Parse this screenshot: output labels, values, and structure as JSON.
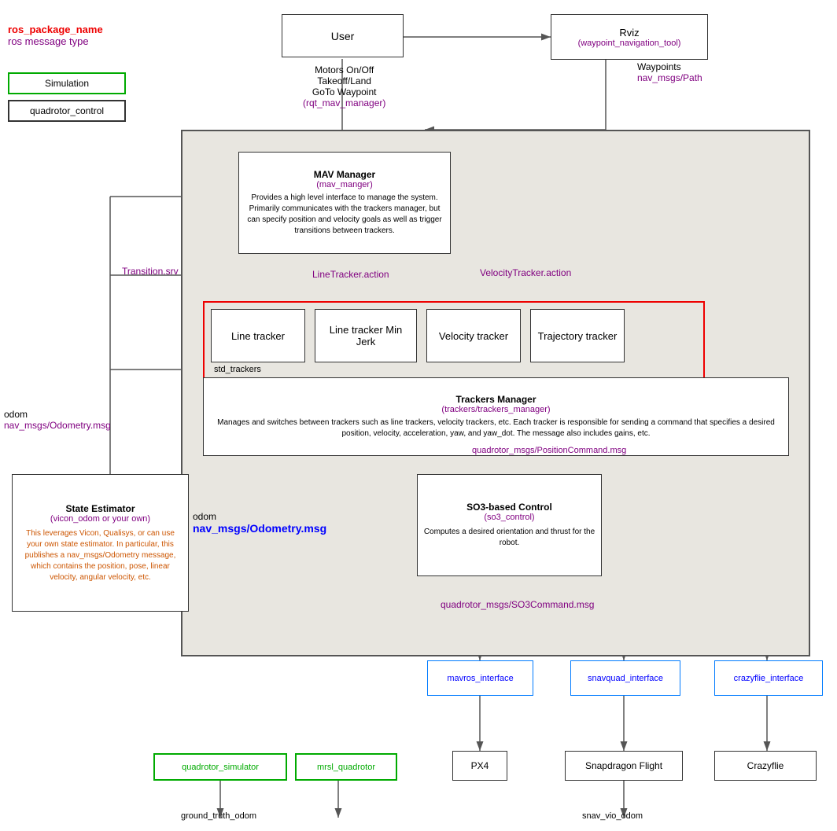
{
  "legend": {
    "ros_package_name": "ros_package_name",
    "ros_message_type": "ros message type",
    "simulation_label": "Simulation",
    "quadrotor_control_label": "quadrotor_control"
  },
  "nodes": {
    "user": {
      "label": "User"
    },
    "rviz": {
      "line1": "Rviz",
      "line2": "(waypoint_navigation_tool)"
    },
    "mav_manager": {
      "title": "MAV Manager",
      "subtitle": "(mav_manger)",
      "desc": "Provides a high level interface to manage the system. Primarily communicates with the trackers manager, but can specify position and velocity goals as well as trigger transitions between trackers."
    },
    "line_tracker": {
      "label": "Line tracker"
    },
    "line_tracker_min_jerk": {
      "label": "Line tracker Min Jerk"
    },
    "velocity_tracker": {
      "label": "Velocity tracker"
    },
    "trajectory_tracker": {
      "label": "Trajectory tracker"
    },
    "std_trackers": {
      "label": "std_trackers"
    },
    "trackers_manager": {
      "title": "Trackers Manager",
      "subtitle": "(trackers/trackers_manager)",
      "desc": "Manages and switches between trackers such as line trackers, velocity trackers, etc. Each tracker is responsible for sending a command that specifies a desired position, velocity, acceleration, yaw, and yaw_dot. The message also includes gains, etc."
    },
    "so3_control": {
      "title": "SO3-based Control",
      "subtitle": "(so3_control)",
      "desc": "Computes a desired orientation and thrust for the robot."
    },
    "state_estimator": {
      "title": "State Estimator",
      "subtitle": "(vicon_odom or your own)",
      "desc": "This leverages Vicon, Qualisys, or can use your own state estimator. In particular, this publishes a nav_msgs/Odometry message, which contains the position, pose, linear velocity, angular velocity, etc."
    },
    "mavros": {
      "label": "mavros_interface"
    },
    "snavquad": {
      "label": "snavquad_interface"
    },
    "crazyflie": {
      "label": "crazyflie_interface"
    },
    "px4": {
      "label": "PX4"
    },
    "snapdragon": {
      "label": "Snapdragon Flight"
    },
    "crazyflie_hw": {
      "label": "Crazyflie"
    },
    "quadrotor_simulator": {
      "label": "quadrotor_simulator"
    },
    "mrsl_quadrotor": {
      "label": "mrsl_quadrotor"
    }
  },
  "edges": {
    "motors_onoff": "Motors On/Off",
    "takeoff_land": "Takeoff/Land",
    "goto_waypoint": "GoTo Waypoint",
    "rqt_mav_manager": "(rqt_mav_manager)",
    "waypoints": "Waypoints",
    "nav_msgs_path": "nav_msgs/Path",
    "transition_srv": "Transition.srv",
    "line_tracker_action": "LineTracker.action",
    "velocity_tracker_action": "VelocityTracker.action",
    "position_command_msg": "quadrotor_msgs/PositionCommand.msg",
    "odom_label": "odom",
    "nav_msgs_odometry": "nav_msgs/Odometry.msg",
    "odom_label2": "odom",
    "nav_msgs_odometry2": "nav_msgs/Odometry.msg",
    "so3_command_msg": "quadrotor_msgs/SO3Command.msg",
    "ground_truth_odom": "ground_truth_odom",
    "snav_vio_odom": "snav_vio_odom"
  }
}
